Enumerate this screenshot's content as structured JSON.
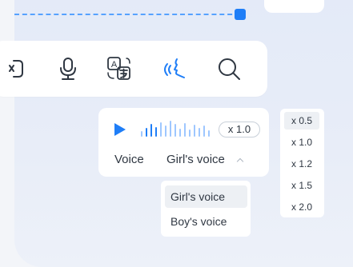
{
  "toolbar": {
    "icons": [
      "crop-icon",
      "microphone-icon",
      "translate-icon",
      "voice-speak-icon",
      "search-icon"
    ],
    "active_icon": "voice-speak-icon",
    "translate_glyph": "A"
  },
  "voice_panel": {
    "speed_badge": "x 1.0",
    "voice_label": "Voice",
    "selected_voice": "Girl's voice"
  },
  "voice_dropdown": {
    "options": [
      "Girl's voice",
      "Boy's voice"
    ],
    "selected_index": 0
  },
  "speed_dropdown": {
    "options": [
      "x 0.5",
      "x 1.0",
      "x 1.2",
      "x 1.5",
      "x 2.0"
    ],
    "selected_index": 0
  },
  "colors": {
    "accent": "#1f7ef7",
    "dash": "#56a2ff",
    "panel_bg": "#e6ecf8",
    "menu_selected_bg": "#edf0f4"
  }
}
